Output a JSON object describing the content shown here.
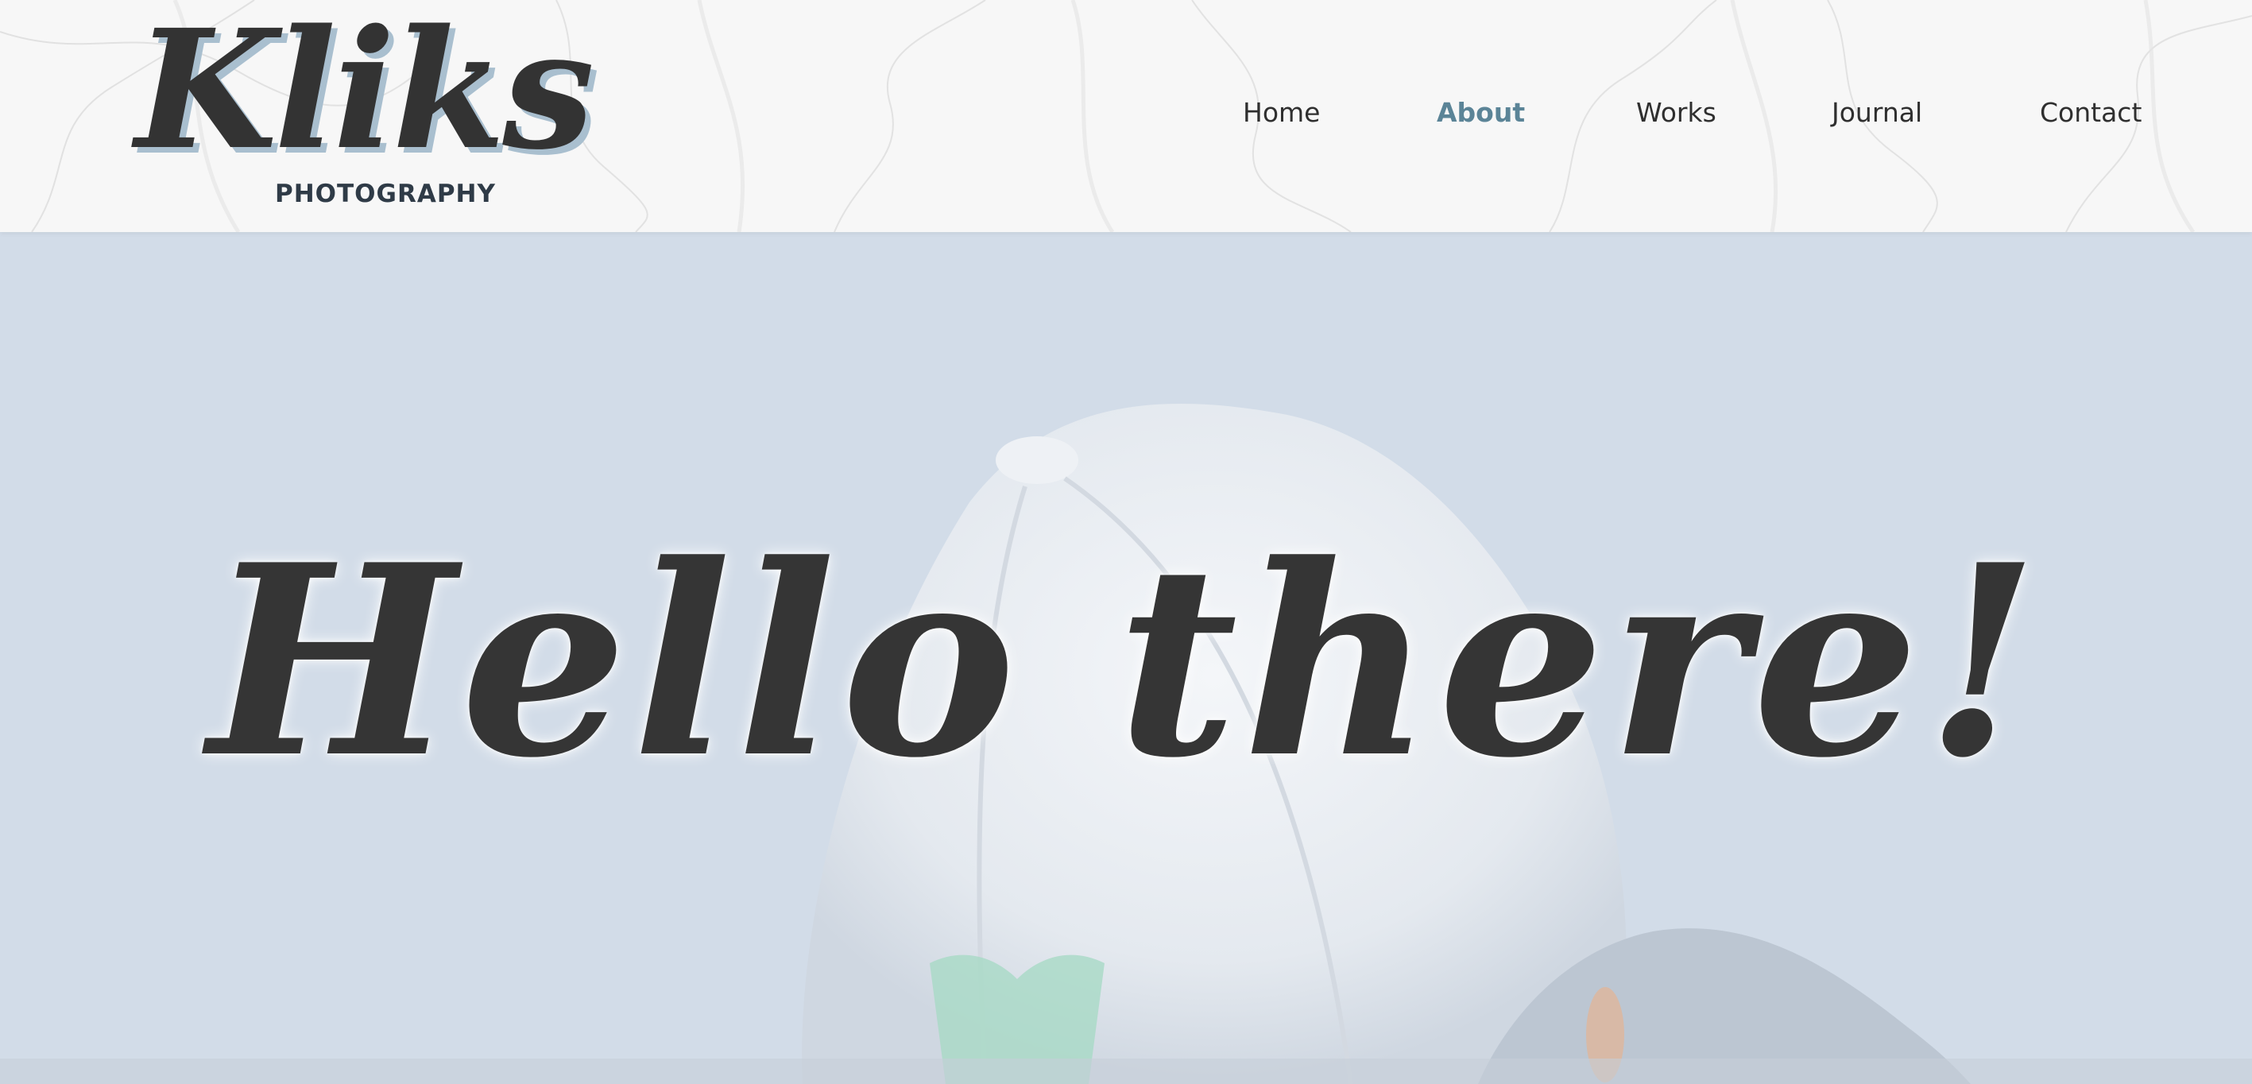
{
  "brand": {
    "name": "Kliks",
    "tagline": "PHOTOGRAPHY",
    "colors": {
      "ink": "#333333",
      "shadow": "#a9bfcf",
      "accent": "#5b8497"
    }
  },
  "nav": {
    "items": [
      {
        "label": "Home",
        "active": false
      },
      {
        "label": "About",
        "active": true
      },
      {
        "label": "Works",
        "active": false
      },
      {
        "label": "Journal",
        "active": false
      },
      {
        "label": "Contact",
        "active": false
      }
    ]
  },
  "hero": {
    "heading": "Hello there!",
    "background_color": "#d2dce8"
  }
}
